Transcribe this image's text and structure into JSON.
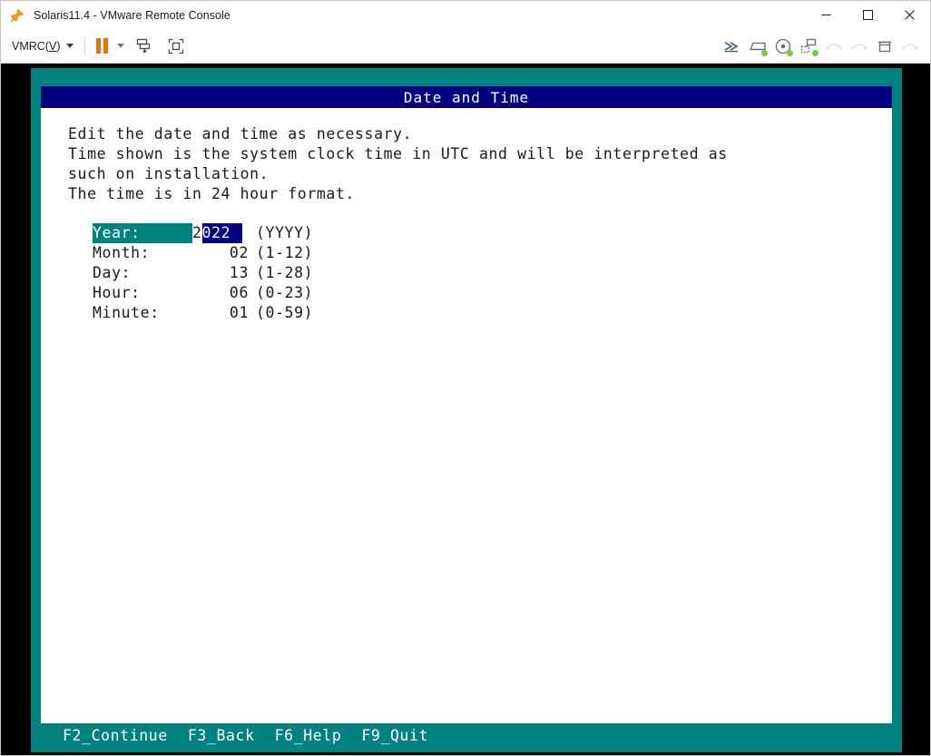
{
  "window": {
    "title": "Solaris11.4 - VMware Remote Console",
    "app_icon": "vmrc-pushpin-icon",
    "controls": {
      "minimize": "minimize-icon",
      "maximize": "maximize-icon",
      "close": "close-icon"
    }
  },
  "toolbar": {
    "vmrc_menu_prefix": "VMRC(",
    "vmrc_menu_mnemonic": "V",
    "vmrc_menu_suffix": ")",
    "pause_button": "pause-icon",
    "pause_dropdown": "chevron-down-icon",
    "send_ctrl_alt_del": "send-keys-icon",
    "fullscreen": "fullscreen-icon",
    "right_icons": [
      "fast-forward-icon",
      "floppy-drive-icon",
      "cd-dvd-drive-icon",
      "network-adapter-icon",
      "usb-device-icon",
      "usb-device-2-icon",
      "printer-icon",
      "more-devices-icon"
    ]
  },
  "terminal": {
    "dialog_title": "Date and Time",
    "intro_lines": [
      "Edit the date and time as necessary.",
      "Time shown is the system clock time in UTC and will be interpreted as",
      "such on installation.",
      "The time is in 24 hour format."
    ],
    "fields": [
      {
        "label": "Year:",
        "value": "2022",
        "value_prefix": "2",
        "value_selected": "022",
        "hint": "(YYYY)",
        "selected": true,
        "editing": true
      },
      {
        "label": "Month:",
        "value": "02",
        "hint": "(1-12)",
        "selected": false,
        "editing": false
      },
      {
        "label": "Day:",
        "value": "13",
        "hint": "(1-28)",
        "selected": false,
        "editing": false
      },
      {
        "label": "Hour:",
        "value": "06",
        "hint": "(0-23)",
        "selected": false,
        "editing": false
      },
      {
        "label": "Minute:",
        "value": "01",
        "hint": "(0-59)",
        "selected": false,
        "editing": false
      }
    ],
    "function_keys": [
      "F2_Continue",
      "F3_Back",
      "F6_Help",
      "F9_Quit"
    ]
  },
  "colors": {
    "teal": "#00827f",
    "navy": "#000080",
    "terminal_bg": "#000000",
    "dialog_bg": "#ffffff",
    "accent_orange": "#e8730c",
    "led_green": "#7ac943"
  }
}
